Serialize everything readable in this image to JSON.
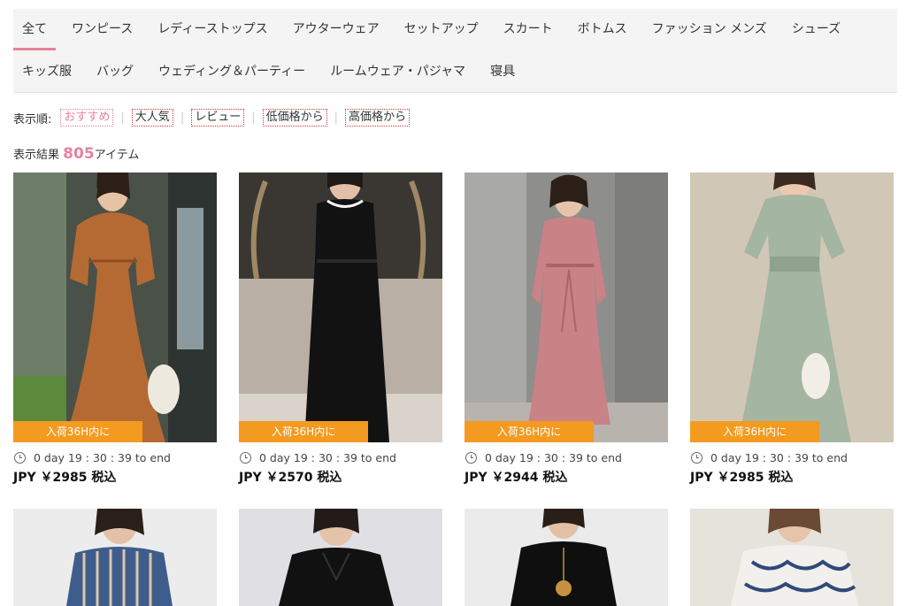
{
  "categories_row1": [
    "全て",
    "ワンピース",
    "レディーストップス",
    "アウターウェア",
    "セットアップ",
    "スカート",
    "ボトムス",
    "ファッション メンズ",
    "シューズ"
  ],
  "categories_row2": [
    "キッズ服",
    "バッグ",
    "ウェディング＆パーティー",
    "ルームウェア・パジャマ",
    "寝具"
  ],
  "sort": {
    "label": "表示順:",
    "options": [
      "おすすめ",
      "大人気",
      "レビュー",
      "低価格から",
      "高価格から"
    ]
  },
  "results": {
    "prefix": "表示結果",
    "count": "805",
    "suffix": "アイテム"
  },
  "products": [
    {
      "badge": "入荷36H内に",
      "timer": "0 day 19 : 30 : 39 to end",
      "price": "JPY ￥2985 税込"
    },
    {
      "badge": "入荷36H内に",
      "timer": "0 day 19 : 30 : 39 to end",
      "price": "JPY ￥2570 税込"
    },
    {
      "badge": "入荷36H内に",
      "timer": "0 day 19 : 30 : 39 to end",
      "price": "JPY ￥2944 税込"
    },
    {
      "badge": "入荷36H内に",
      "timer": "0 day 19 : 30 : 39 to end",
      "price": "JPY ￥2985 税込"
    }
  ],
  "colors": {
    "accent": "#e8819b",
    "badge": "#f39a20"
  }
}
